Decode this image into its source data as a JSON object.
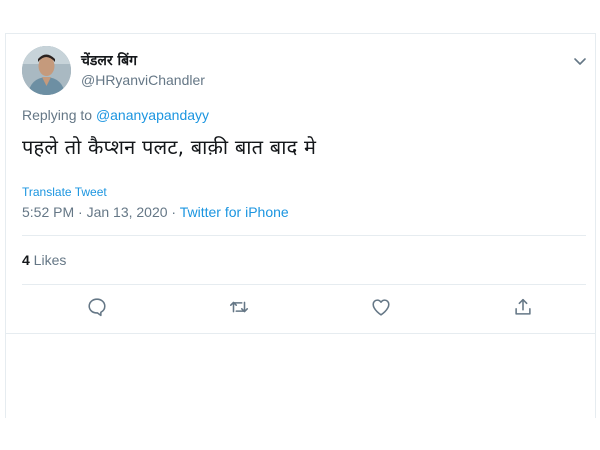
{
  "tweet": {
    "display_name": "चेंडलर बिंग",
    "username": "@HRyanviChandler",
    "reply_prefix": "Replying to ",
    "reply_to": "@ananyapandayy",
    "text": "पहले तो कैप्शन पलट, बाक़ी बात बाद मे",
    "translate_label": "Translate Tweet",
    "timestamp": "5:52 PM · Jan 13, 2020 · ",
    "source": "Twitter for iPhone",
    "likes_count": "4",
    "likes_label": " Likes"
  },
  "icons": {
    "caret": "chevron-down-icon",
    "reply": "reply-icon",
    "retweet": "retweet-icon",
    "like": "heart-icon",
    "share": "share-icon"
  },
  "colors": {
    "link": "#1b95e0",
    "secondary_text": "#657786",
    "border": "#e6ecf0"
  }
}
